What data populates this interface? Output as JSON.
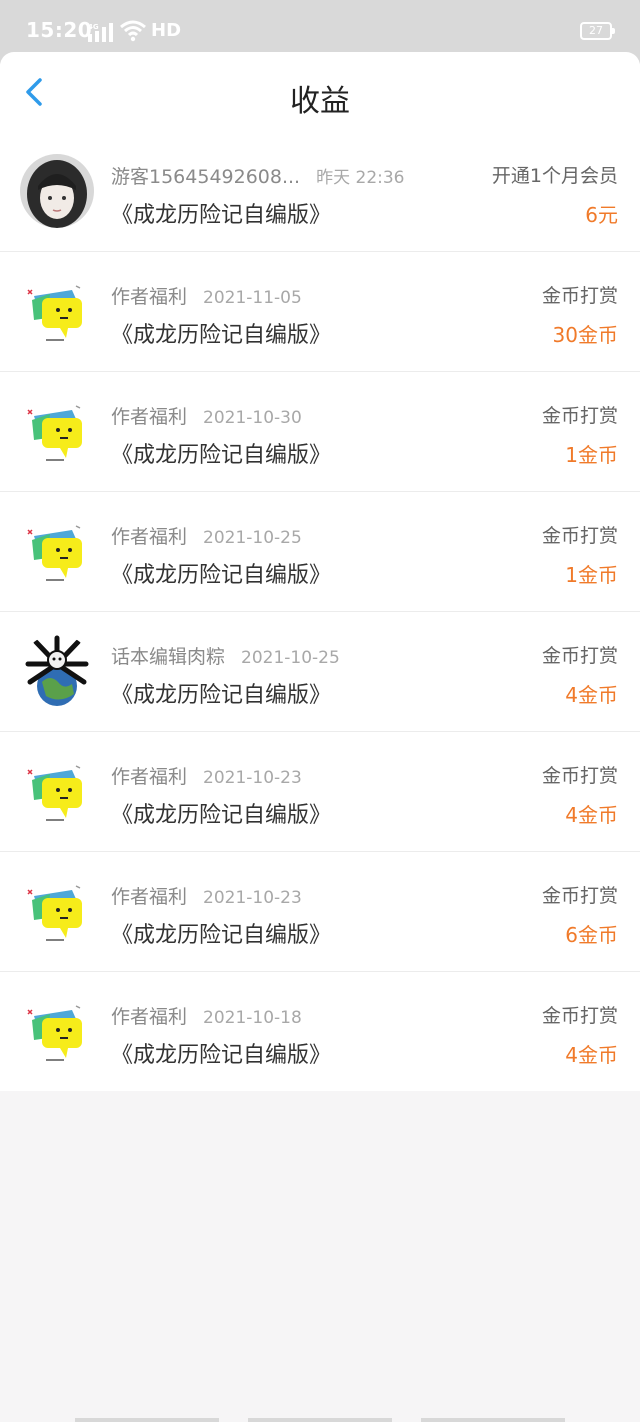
{
  "status_bar": {
    "time": "15:20",
    "network": "4G",
    "hd": "HD",
    "battery": "27"
  },
  "header": {
    "title": "收益"
  },
  "records": [
    {
      "user": "游客15645492608...",
      "date": "昨天 22:36",
      "work": "《成龙历险记自编版》",
      "type": "开通1个月会员",
      "amount": "6元",
      "avatar": "photo"
    },
    {
      "user": "作者福利",
      "date": "2021-11-05",
      "work": "《成龙历险记自编版》",
      "type": "金币打赏",
      "amount": "30金币",
      "avatar": "mascot"
    },
    {
      "user": "作者福利",
      "date": "2021-10-30",
      "work": "《成龙历险记自编版》",
      "type": "金币打赏",
      "amount": "1金币",
      "avatar": "mascot"
    },
    {
      "user": "作者福利",
      "date": "2021-10-25",
      "work": "《成龙历险记自编版》",
      "type": "金币打赏",
      "amount": "1金币",
      "avatar": "mascot"
    },
    {
      "user": "话本编辑肉粽",
      "date": "2021-10-25",
      "work": "《成龙历险记自编版》",
      "type": "金币打赏",
      "amount": "4金币",
      "avatar": "globe"
    },
    {
      "user": "作者福利",
      "date": "2021-10-23",
      "work": "《成龙历险记自编版》",
      "type": "金币打赏",
      "amount": "4金币",
      "avatar": "mascot"
    },
    {
      "user": "作者福利",
      "date": "2021-10-23",
      "work": "《成龙历险记自编版》",
      "type": "金币打赏",
      "amount": "6金币",
      "avatar": "mascot"
    },
    {
      "user": "作者福利",
      "date": "2021-10-18",
      "work": "《成龙历险记自编版》",
      "type": "金币打赏",
      "amount": "4金币",
      "avatar": "mascot"
    }
  ],
  "colors": {
    "accent": "#2f9bea",
    "amount": "#f07a2a",
    "background": "#f6f5f6"
  }
}
